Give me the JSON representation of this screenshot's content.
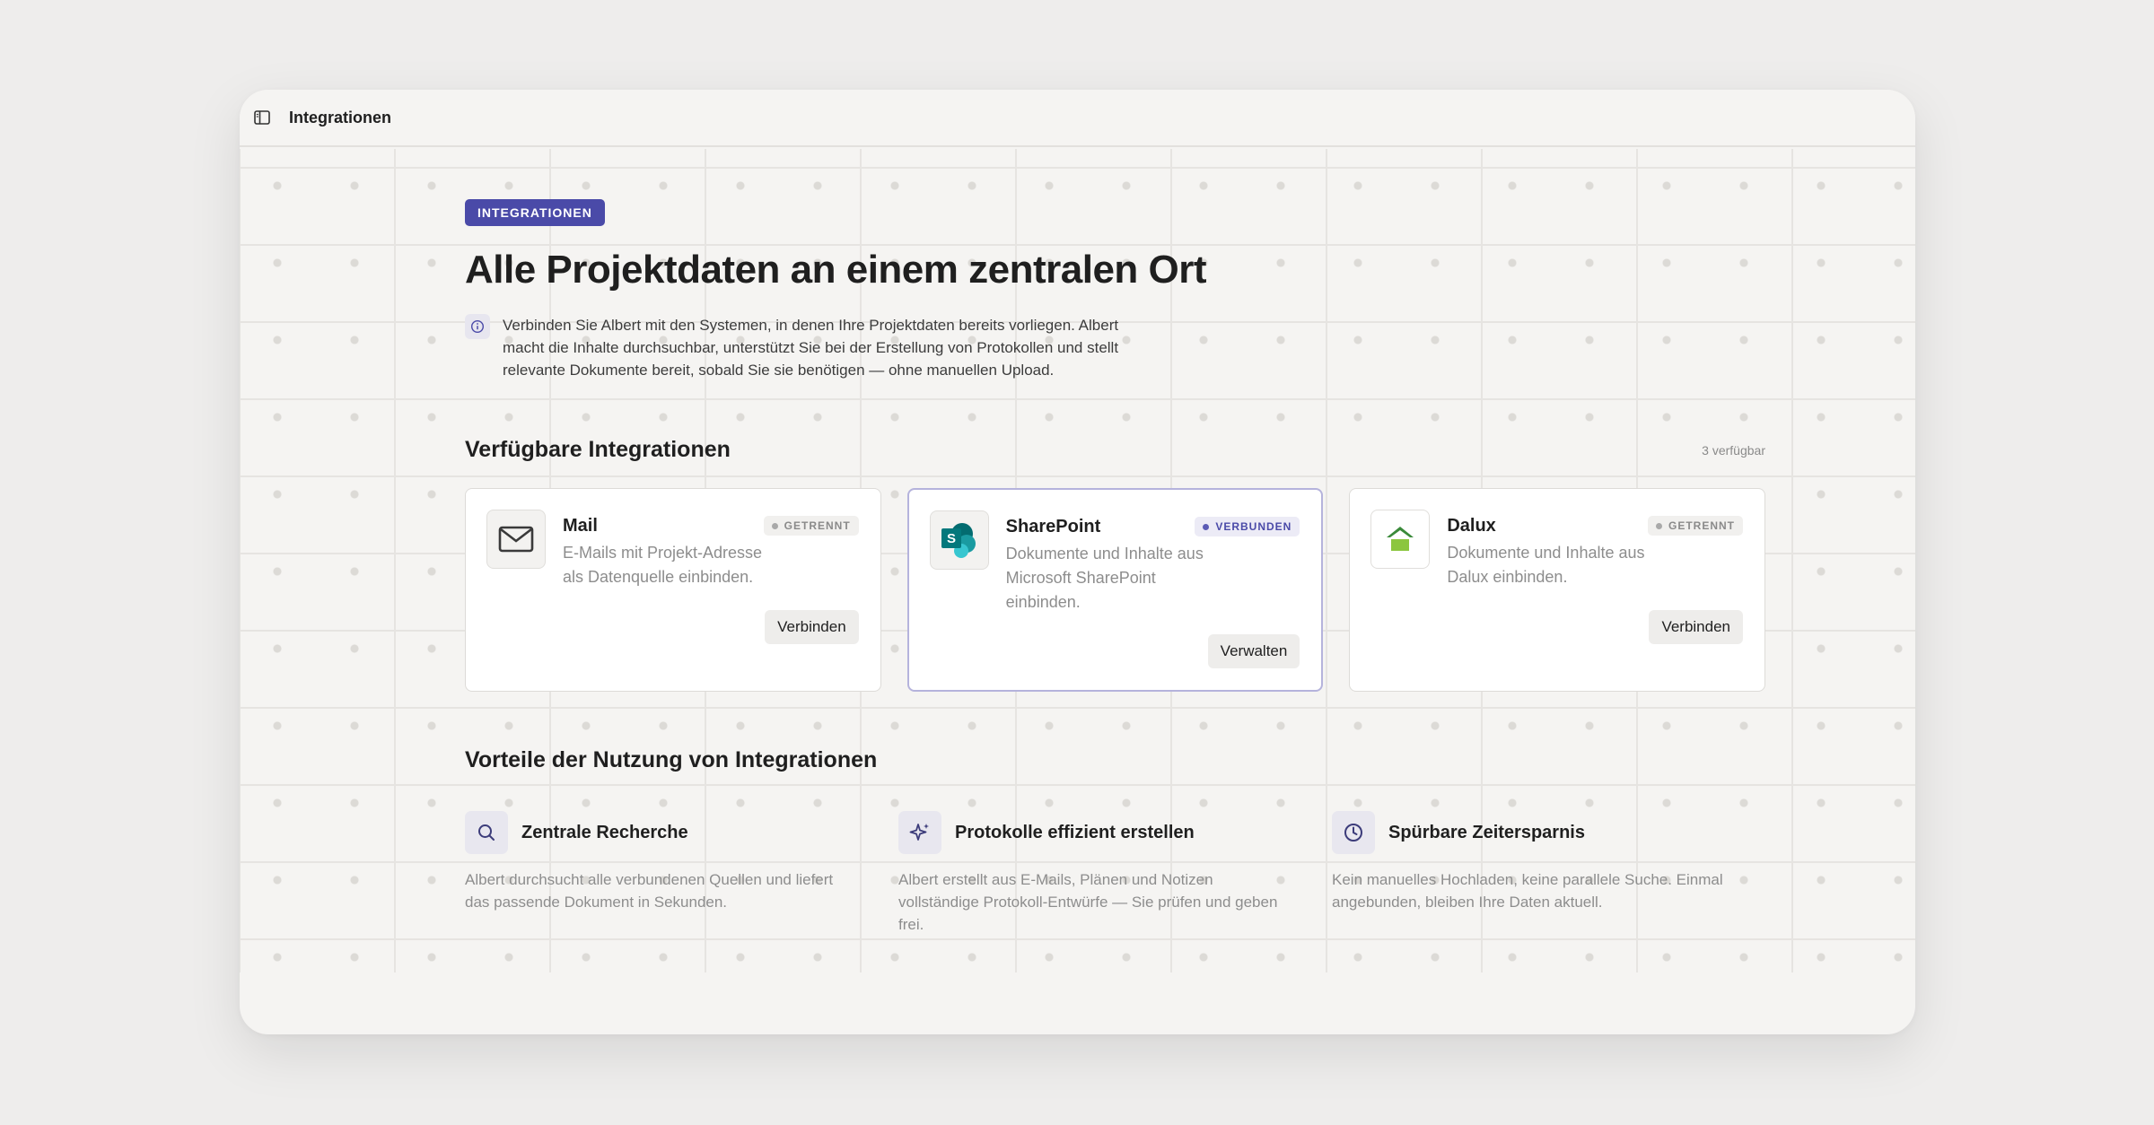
{
  "topbar": {
    "title": "Integrationen",
    "toggle_icon": "sidebar-toggle-icon"
  },
  "hero": {
    "badge": "INTEGRATIONEN",
    "headline": "Alle Projektdaten an einem zentralen Ort",
    "info_text": "Verbinden Sie Albert mit den Systemen, in denen Ihre Projektdaten bereits vorliegen. Albert macht die Inhalte durchsuchbar, unterstützt Sie bei der Erstellung von Protokollen und stellt relevante Dokumente bereit, sobald Sie sie benötigen — ohne manuellen Upload."
  },
  "integrations": {
    "title": "Verfügbare Integrationen",
    "count": "3 verfügbar",
    "cards": [
      {
        "name": "Mail",
        "status": "GETRENNT",
        "description": "E-Mails mit Projekt-Adresse als Datenquelle einbinden.",
        "button": "Verbinden",
        "icon": "mail-icon"
      },
      {
        "name": "SharePoint",
        "status": "VERBUNDEN",
        "description": "Dokumente und Inhalte aus Microsoft SharePoint einbinden.",
        "button": "Verwalten",
        "icon": "sharepoint-logo"
      },
      {
        "name": "Dalux",
        "status": "GETRENNT",
        "description": "Dokumente und Inhalte aus Dalux einbinden.",
        "button": "Verbinden",
        "icon": "dalux-logo"
      }
    ]
  },
  "benefits": {
    "title": "Vorteile der Nutzung von Integrationen",
    "items": [
      {
        "title": "Zentrale Recherche",
        "text": "Albert durchsucht alle verbundenen Quellen und liefert das passende Dokument in Sekunden.",
        "icon": "search-icon"
      },
      {
        "title": "Protokolle effizient erstellen",
        "text": "Albert erstellt aus E-Mails, Plänen und Notizen vollständige Protokoll-Entwürfe — Sie prüfen und geben frei.",
        "icon": "sparkle-icon"
      },
      {
        "title": "Spürbare Zeitersparnis",
        "text": "Kein manuelles Hochladen, keine parallele Suche. Einmal angebunden, bleiben Ihre Daten aktuell.",
        "icon": "clock-icon"
      }
    ]
  },
  "colors": {
    "accent": "#4a4aa8",
    "background": "#eeedec",
    "window": "#f5f4f2"
  }
}
